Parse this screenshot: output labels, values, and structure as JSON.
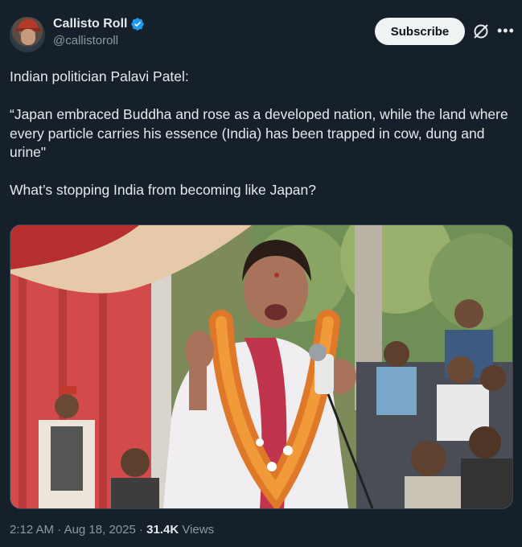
{
  "author": {
    "display_name": "Callisto Roll",
    "handle": "@callistoroll",
    "verified": true
  },
  "actions": {
    "subscribe_label": "Subscribe",
    "grok_icon": "grok-icon",
    "more_icon": "more-icon"
  },
  "tweet": {
    "line1": "Indian politician Palavi Patel:",
    "quote": "“Japan embraced Buddha and rose as a developed nation, while the land where every particle carries his essence (India) has been trapped in cow, dung and urine\"",
    "question": "What’s stopping India from becoming like Japan?"
  },
  "media": {
    "type": "photo"
  },
  "meta": {
    "time": "2:12 AM",
    "date": "Aug 18, 2025",
    "separator": "·",
    "views_count": "31.4K",
    "views_label": "Views"
  },
  "colors": {
    "background": "#15202b",
    "text": "#e7e9ea",
    "secondary_text": "#8b98a5",
    "verified_blue": "#1d9bf0"
  }
}
